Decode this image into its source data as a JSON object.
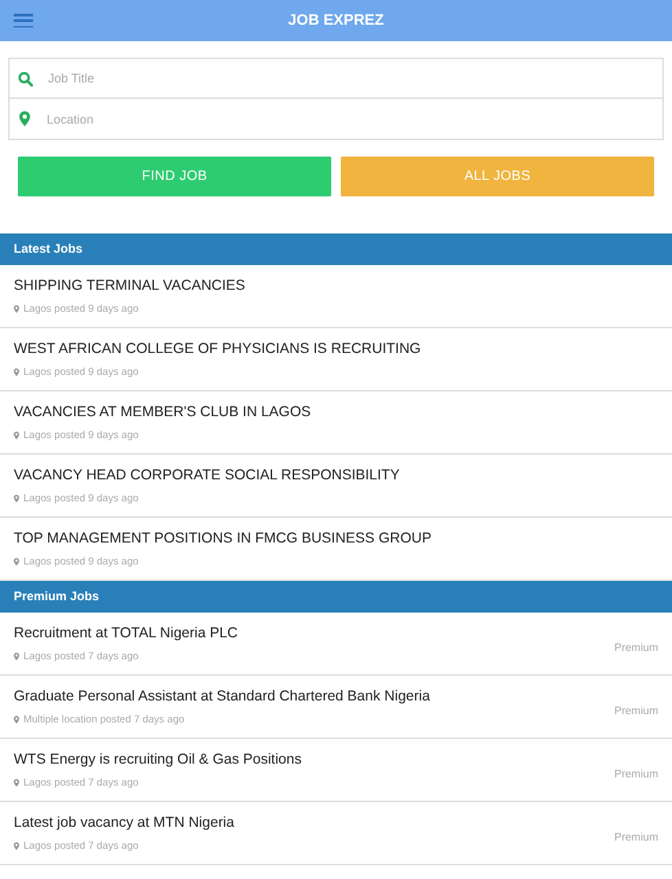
{
  "app_bar": {
    "title": "JOB EXPREZ"
  },
  "search": {
    "job_title": {
      "placeholder": "Job Title"
    },
    "location": {
      "placeholder": "Location"
    }
  },
  "buttons": [
    {
      "label": "FIND JOB",
      "kind": "primary"
    },
    {
      "label": "ALL JOBS",
      "kind": "secondary"
    }
  ],
  "sections": [
    {
      "title": "Latest Jobs",
      "jobs": [
        {
          "title": "SHIPPING TERMINAL VACANCIES",
          "meta": "Lagos posted 9 days ago"
        },
        {
          "title": "WEST AFRICAN COLLEGE OF PHYSICIANS IS RECRUITING",
          "meta": "Lagos posted 9 days ago"
        },
        {
          "title": "VACANCIES AT MEMBER'S CLUB IN LAGOS",
          "meta": "Lagos posted 9 days ago"
        },
        {
          "title": "VACANCY HEAD CORPORATE SOCIAL RESPONSIBILITY",
          "meta": "Lagos posted 9 days ago"
        },
        {
          "title": "TOP MANAGEMENT POSITIONS IN FMCG BUSINESS GROUP",
          "meta": "Lagos posted 9 days ago"
        }
      ]
    },
    {
      "title": "Premium Jobs",
      "jobs": [
        {
          "title": "Recruitment at TOTAL Nigeria PLC",
          "meta": "Lagos posted 7 days ago",
          "badge": "Premium"
        },
        {
          "title": "Graduate Personal Assistant at Standard Chartered Bank Nigeria",
          "meta": "Multiple location posted 7 days ago",
          "badge": "Premium"
        },
        {
          "title": "WTS Energy is recruiting Oil & Gas Positions",
          "meta": "Lagos posted 7 days ago",
          "badge": "Premium"
        },
        {
          "title": "Latest job vacancy at MTN Nigeria",
          "meta": "Lagos posted 7 days ago",
          "badge": "Premium"
        }
      ]
    }
  ]
}
